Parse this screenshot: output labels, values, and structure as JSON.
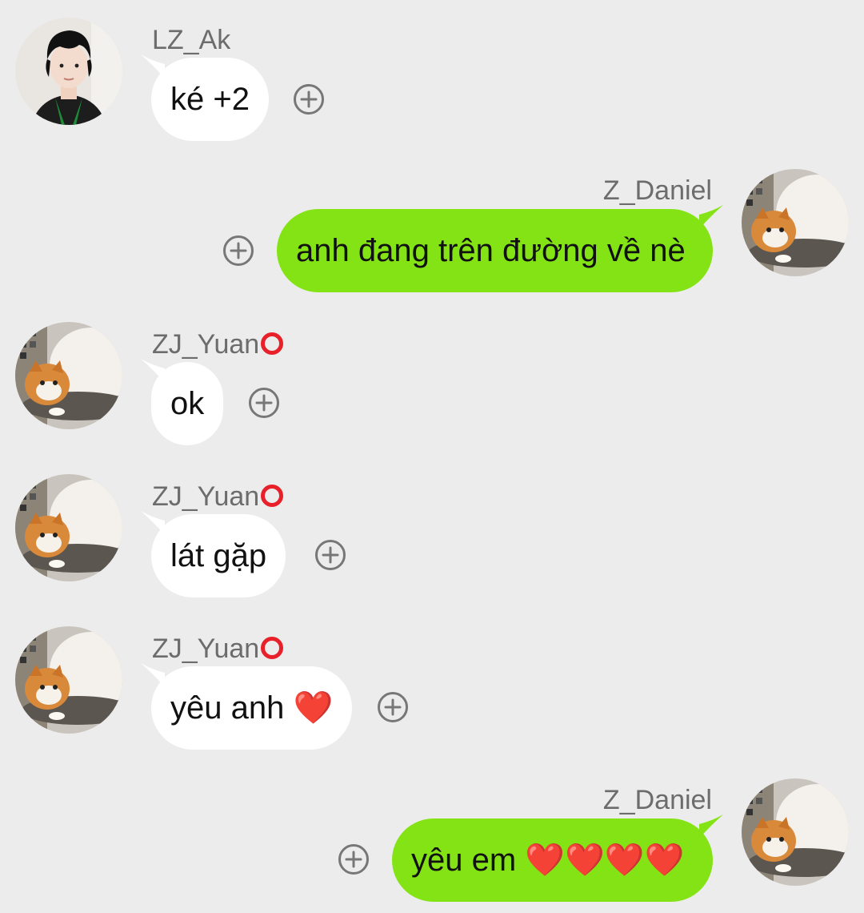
{
  "messages": [
    {
      "sender": "LZ_Ak",
      "text": "ké +2",
      "side": "incoming",
      "avatar": "person-photo",
      "badge": false
    },
    {
      "sender": "Z_Daniel",
      "text": "anh đang trên đường về nè",
      "side": "outgoing",
      "avatar": "cat-photo",
      "badge": false
    },
    {
      "sender": "ZJ_Yuan",
      "text": "ok",
      "side": "incoming",
      "avatar": "cat-photo",
      "badge": true
    },
    {
      "sender": "ZJ_Yuan",
      "text": "lát gặp",
      "side": "incoming",
      "avatar": "cat-photo",
      "badge": true
    },
    {
      "sender": "ZJ_Yuan",
      "text": "yêu anh ❤️",
      "side": "incoming",
      "avatar": "cat-photo",
      "badge": true
    },
    {
      "sender": "Z_Daniel",
      "text": "yêu em ❤️❤️❤️❤️",
      "side": "outgoing",
      "avatar": "cat-photo",
      "badge": false
    }
  ],
  "colors": {
    "background": "#ececec",
    "incoming_bubble": "#ffffff",
    "outgoing_bubble": "#84e314",
    "sender_name": "#6c6c6c",
    "badge_ring": "#e8202a"
  },
  "icons": {
    "react_button": "plus-circle-icon",
    "name_badge": "red-ring-icon"
  }
}
